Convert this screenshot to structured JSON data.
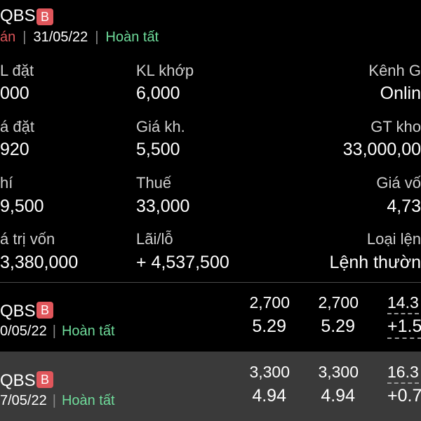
{
  "detail": {
    "ticker": "QBS",
    "badge": "B",
    "side_fragment": "án",
    "date": "31/05/22",
    "status": "Hoàn tất",
    "fields": {
      "kl_dat": {
        "label": "L đặt",
        "value": "000"
      },
      "kl_khop": {
        "label": "KL khớp",
        "value": "6,000"
      },
      "kenh": {
        "label": "Kênh G",
        "value": "Onlin"
      },
      "gia_dat": {
        "label": "á đặt",
        "value": "920"
      },
      "gia_khop": {
        "label": "Giá kh.",
        "value": "5,500"
      },
      "gt_khop": {
        "label": "GT kho",
        "value": "33,000,00"
      },
      "phi": {
        "label": "hí",
        "value": "9,500"
      },
      "thue": {
        "label": "Thuế",
        "value": "33,000"
      },
      "gia_von": {
        "label": "Giá vố",
        "value": "4,73"
      },
      "gia_tri_von": {
        "label": "á trị vốn",
        "value": "3,380,000"
      },
      "lai_lo": {
        "label": "Lãi/lỗ",
        "value": "+ 4,537,500"
      },
      "loai_lenh": {
        "label": "Loại lện",
        "value": "Lệnh thườn"
      }
    }
  },
  "rows": [
    {
      "ticker": "QBS",
      "badge": "B",
      "date": "0/05/22",
      "status": "Hoàn tất",
      "c1_top": "2,700",
      "c1_bottom": "5.29",
      "c2_top": "2,700",
      "c2_bottom": "5.29",
      "c3_top": "14.3",
      "c3_bottom": "+1.5"
    },
    {
      "ticker": "QBS",
      "badge": "B",
      "date": "7/05/22",
      "status": "Hoàn tất",
      "c1_top": "3,300",
      "c1_bottom": "4.94",
      "c2_top": "3,300",
      "c2_bottom": "4.94",
      "c3_top": "16.3",
      "c3_bottom": "+0.7"
    }
  ],
  "colors": {
    "positive": "#6fdc9b",
    "badge": "#e0565b",
    "highlight_row": "#3a3a3a"
  }
}
